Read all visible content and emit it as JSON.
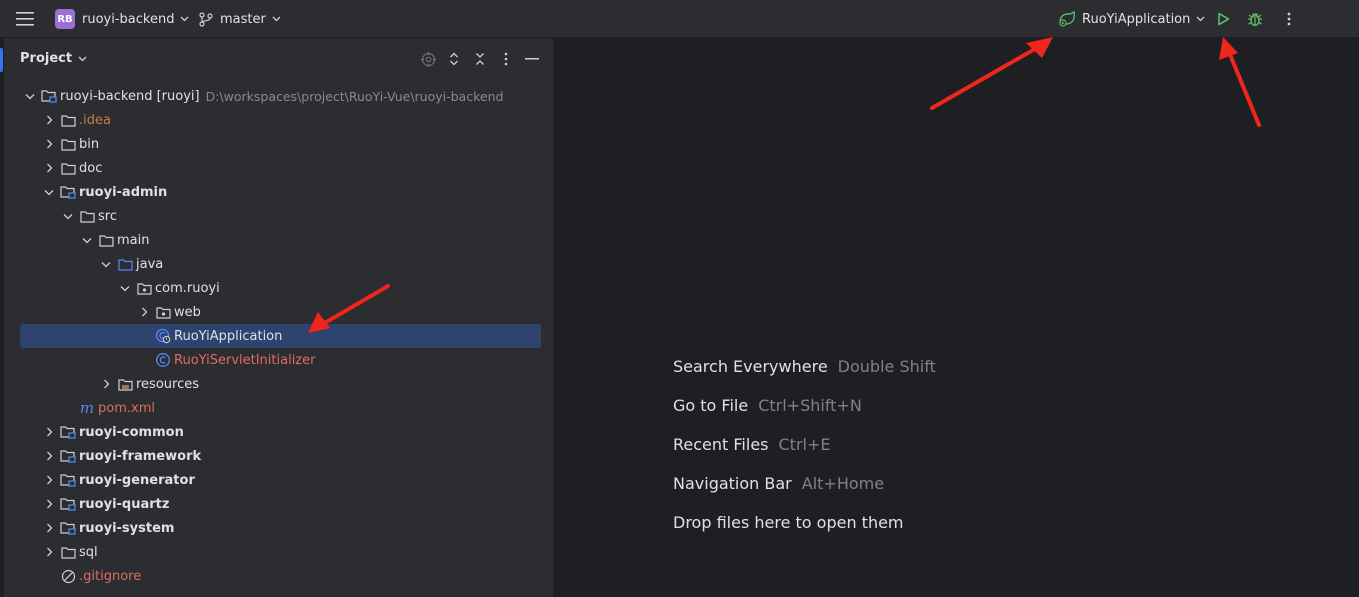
{
  "titlebar": {
    "project_badge": "RB",
    "project_name": "ruoyi-backend",
    "branch": "master",
    "run_config": "RuoYiApplication"
  },
  "project_panel": {
    "title": "Project",
    "tree": [
      {
        "label": "ruoyi-backend [ruoyi]",
        "path": "D:\\workspaces\\project\\RuoYi-Vue\\ruoyi-backend",
        "depth": 0,
        "expanded": true,
        "icon": "module-folder-icon",
        "style": "normal"
      },
      {
        "label": ".idea",
        "depth": 1,
        "expanded": false,
        "icon": "folder-icon",
        "style": "orange"
      },
      {
        "label": "bin",
        "depth": 1,
        "expanded": false,
        "icon": "folder-icon",
        "style": "normal"
      },
      {
        "label": "doc",
        "depth": 1,
        "expanded": false,
        "icon": "folder-icon",
        "style": "normal"
      },
      {
        "label": "ruoyi-admin",
        "depth": 1,
        "expanded": true,
        "icon": "module-folder-icon",
        "style": "bold"
      },
      {
        "label": "src",
        "depth": 2,
        "expanded": true,
        "icon": "folder-icon",
        "style": "normal"
      },
      {
        "label": "main",
        "depth": 3,
        "expanded": true,
        "icon": "folder-icon",
        "style": "normal"
      },
      {
        "label": "java",
        "depth": 4,
        "expanded": true,
        "icon": "source-folder-icon",
        "style": "normal"
      },
      {
        "label": "com.ruoyi",
        "depth": 5,
        "expanded": true,
        "icon": "package-icon",
        "style": "normal"
      },
      {
        "label": "web",
        "depth": 6,
        "expanded": false,
        "icon": "package-icon",
        "style": "normal"
      },
      {
        "label": "RuoYiApplication",
        "depth": 6,
        "leaf": true,
        "icon": "spring-boot-class-icon",
        "style": "normal",
        "selected": true
      },
      {
        "label": "RuoYiServletInitializer",
        "depth": 6,
        "leaf": true,
        "icon": "class-icon",
        "style": "red"
      },
      {
        "label": "resources",
        "depth": 4,
        "expanded": false,
        "icon": "resources-folder-icon",
        "style": "normal"
      },
      {
        "label": "pom.xml",
        "depth": 2,
        "leaf": true,
        "icon": "maven-icon",
        "style": "red"
      },
      {
        "label": "ruoyi-common",
        "depth": 1,
        "expanded": false,
        "icon": "module-folder-icon",
        "style": "bold"
      },
      {
        "label": "ruoyi-framework",
        "depth": 1,
        "expanded": false,
        "icon": "module-folder-icon",
        "style": "bold"
      },
      {
        "label": "ruoyi-generator",
        "depth": 1,
        "expanded": false,
        "icon": "module-folder-icon",
        "style": "bold"
      },
      {
        "label": "ruoyi-quartz",
        "depth": 1,
        "expanded": false,
        "icon": "module-folder-icon",
        "style": "bold"
      },
      {
        "label": "ruoyi-system",
        "depth": 1,
        "expanded": false,
        "icon": "module-folder-icon",
        "style": "bold"
      },
      {
        "label": "sql",
        "depth": 1,
        "expanded": false,
        "icon": "folder-icon",
        "style": "normal"
      },
      {
        "label": ".gitignore",
        "depth": 1,
        "leaf": true,
        "icon": "ignore-file-icon",
        "style": "red"
      }
    ]
  },
  "editor": {
    "hints": [
      {
        "label": "Search Everywhere",
        "key": "Double Shift"
      },
      {
        "label": "Go to File",
        "key": "Ctrl+Shift+N"
      },
      {
        "label": "Recent Files",
        "key": "Ctrl+E"
      },
      {
        "label": "Navigation Bar",
        "key": "Alt+Home"
      },
      {
        "label": "Drop files here to open them",
        "key": ""
      }
    ]
  },
  "colors": {
    "accent": "#3574f0",
    "selection": "#2e436e",
    "run_green": "#5fb865",
    "annotation_red": "#f0261d"
  }
}
